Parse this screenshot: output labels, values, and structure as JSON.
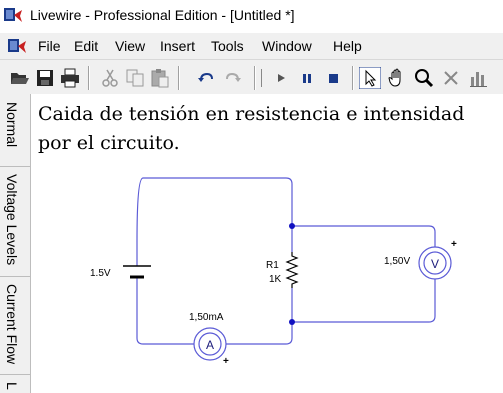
{
  "window": {
    "title": "Livewire - Professional Edition - [Untitled *]"
  },
  "menu": {
    "items": [
      "File",
      "Edit",
      "View",
      "Insert",
      "Tools",
      "Window",
      "Help"
    ]
  },
  "toolbar": {
    "buttons": [
      "open-icon",
      "save-icon",
      "print-icon",
      "cut-icon",
      "copy-icon",
      "paste-icon",
      "undo-icon",
      "redo-icon",
      "step-icon",
      "play-icon",
      "pause-icon",
      "stop-icon",
      "pointer-icon",
      "hand-icon",
      "zoom-icon",
      "delete-icon",
      "graph-icon"
    ]
  },
  "side_tabs": [
    "Normal",
    "Voltage Levels",
    "Current Flow",
    "L"
  ],
  "canvas": {
    "heading": "Caida de tensión en resistencia e intensidad por el circuito.",
    "battery": {
      "label": "1.5V"
    },
    "resistor": {
      "name": "R1",
      "value": "1K"
    },
    "voltmeter": {
      "reading": "1,50V",
      "symbol": "V",
      "polarity": "+"
    },
    "ammeter": {
      "reading": "1,50mA",
      "symbol": "A",
      "polarity": "+"
    },
    "wire_color": "#5b5bd6",
    "node_color": "#1010c0"
  }
}
